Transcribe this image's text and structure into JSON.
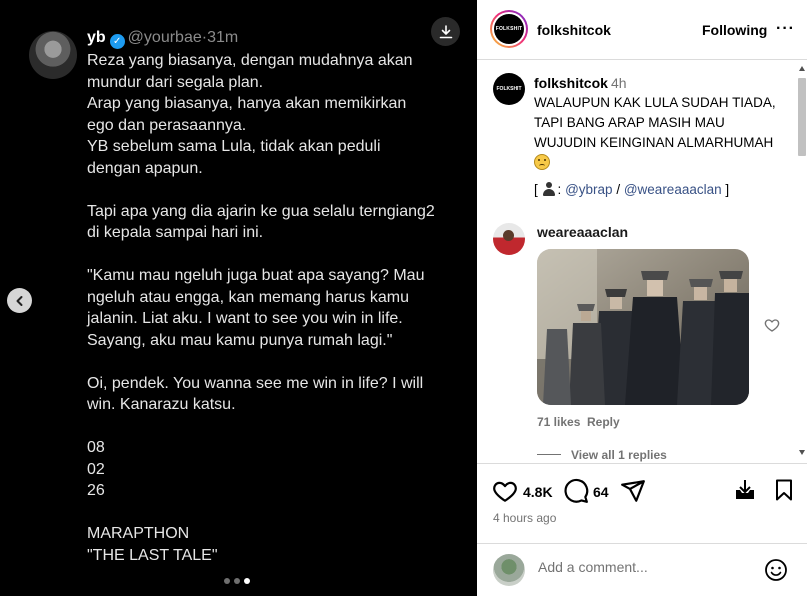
{
  "tweet": {
    "display_name": "yb",
    "handle": "@yourbae",
    "separator": "·",
    "time": "31m",
    "paragraphs": [
      "Reza yang biasanya, dengan mudahnya akan\nmundur dari segala plan.\nArap yang biasanya, hanya akan memikirkan\nego dan perasaannya.\nYB sebelum sama Lula, tidak akan peduli\ndengan apapun.",
      "Tapi apa yang dia ajarin ke gua selalu terngiang2\ndi kepala sampai hari ini.",
      "\"Kamu mau ngeluh juga buat apa sayang? Mau\nngeluh atau engga, kan memang harus kamu\njalanin. Liat aku. I want to see you win in life.\nSayang, aku mau kamu punya rumah lagi.\"",
      "Oi, pendek. You wanna see me win in life? I will\nwin. Kanarazu katsu.",
      "08\n02\n26",
      "MARAPTHON\n\"THE LAST TALE\""
    ]
  },
  "carousel": {
    "count": 3,
    "active_index": 2
  },
  "post": {
    "username": "folkshitcok",
    "avatar_text": "FOLKSHIT",
    "follow_label": "Following",
    "more_label": "···"
  },
  "caption": {
    "username": "folkshitcok",
    "time": "4h",
    "text": "WALAUPUN KAK LULA SUDAH TIADA,\nTAPI BANG ARAP MASIH MAU\nWUJUDIN KEINGINAN ALMARHUMAH",
    "credits_open": "[",
    "credits_colon": ":",
    "mention_1": "@ybrap",
    "credits_slash": "/",
    "mention_2": "@weareaaaclan",
    "credits_close": "]"
  },
  "comment": {
    "username": "weareaaaclan",
    "likes": "71 likes",
    "reply_label": "Reply",
    "view_replies": "View all 1 replies"
  },
  "actions": {
    "like_count": "4.8K",
    "comment_count": "64",
    "time": "4 hours ago"
  },
  "add_comment": {
    "placeholder": "Add a comment..."
  },
  "icons": {
    "download": "download-icon",
    "prev": "chevron-left-icon",
    "like": "heart-icon",
    "comment": "comment-icon",
    "share": "share-icon",
    "save_media": "download-tray-icon",
    "bookmark": "bookmark-icon",
    "emoji": "smiley-icon"
  },
  "colors": {
    "link": "#385185",
    "verified": "#1d9bf0",
    "muted": "#737373"
  }
}
